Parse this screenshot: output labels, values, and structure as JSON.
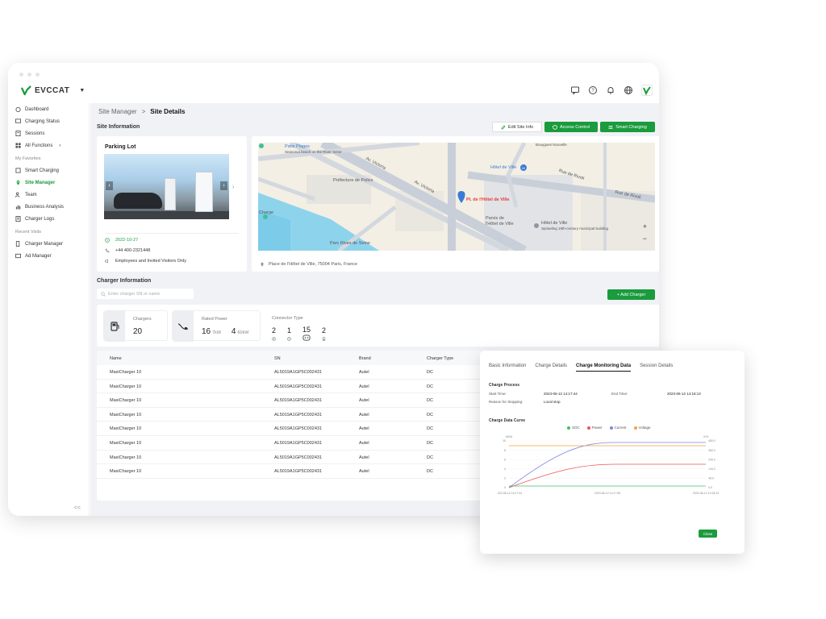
{
  "app": {
    "name": "EVCCAT"
  },
  "colors": {
    "accent": "#1a9b3d",
    "soc": "#3fbf6b",
    "power": "#ef5350",
    "current": "#7e87e0",
    "voltage": "#f2a23c"
  },
  "topbar": {
    "icons": [
      "message-icon",
      "help-icon",
      "bell-icon",
      "globe-icon",
      "brand-icon"
    ]
  },
  "sidebar": {
    "items": [
      {
        "label": "Dashboard",
        "icon": "dashboard-icon"
      },
      {
        "label": "Charging Status",
        "icon": "monitor-icon"
      },
      {
        "label": "Sessions",
        "icon": "list-icon"
      },
      {
        "label": "All Functions",
        "icon": "grid-icon"
      }
    ],
    "favorites_label": "My Favorites",
    "favorites": [
      {
        "label": "Smart Charging",
        "icon": "smart-icon"
      },
      {
        "label": "Site Manager",
        "icon": "location-icon"
      },
      {
        "label": "Team",
        "icon": "team-icon"
      },
      {
        "label": "Business Analysis",
        "icon": "analysis-icon"
      },
      {
        "label": "Charger Logs",
        "icon": "logs-icon"
      }
    ],
    "recent_label": "Recent Visits",
    "recent": [
      {
        "label": "Charger Manager",
        "icon": "charger-icon"
      },
      {
        "label": "Ad Manager",
        "icon": "ad-icon"
      }
    ],
    "collapse": "<<"
  },
  "breadcrumb": {
    "parent": "Site Manager",
    "sep": ">",
    "current": "Site Details"
  },
  "site_info": {
    "title": "Site Information",
    "edit_btn": "Edit Site Info",
    "access_btn": "Access Control",
    "smart_btn": "Smart Charging",
    "parking_title": "Parking Lot",
    "date": "2022-10-27",
    "phone": "+44 400-2321448",
    "access": "Employees and Invited Visitors Only"
  },
  "map": {
    "labels": {
      "paris_plages": "Paris Plages",
      "paris_plages_sub": "Seasonal beach on the River Seine",
      "prefecture": "Préfecture de Police",
      "av_victoria1": "Av. Victoria",
      "av_victoria2": "Av. Victoria",
      "hotel_ville_metro": "Hôtel de Ville",
      "rue_rivoli1": "Rue de Rivoli",
      "rue_rivoli2": "Rue de Rivoli",
      "pl_hotel": "Pl. de l'Hôtel de Ville",
      "parvis": "Parvis de",
      "parvis2": "l'Hôtel de Ville",
      "hotel_ville": "Hôtel de Ville",
      "hotel_sub": "Sprawling 19th-century municipal building",
      "charge": "Charge",
      "parc_rives": "Parc Rives de Seine",
      "top_label": "Bouygues Nouvelle"
    },
    "zoom_in": "+",
    "zoom_out": "−",
    "address": "Place de l'Hôtel de Ville, 75004 Paris, France"
  },
  "charger_info": {
    "title": "Charger Information",
    "search_placeholder": "Enter charger SN or name",
    "add_btn": "+ Add Charger",
    "chargers_label": "Chargers",
    "chargers_value": "20",
    "rated_label": "Rated Power",
    "rated_1_count": "16",
    "rated_1_unit": "7kW",
    "rated_2_count": "4",
    "rated_2_unit": "60kW",
    "connector_label": "Connector Type",
    "connectors": [
      "2",
      "1",
      "15",
      "2"
    ]
  },
  "table": {
    "headers": {
      "name": "Name",
      "sn": "SN",
      "brand": "Brand",
      "type": "Charger Type"
    },
    "rows": [
      {
        "name": "MaxiCharger 10",
        "sn": "AL5019A1GP5C002431",
        "brand": "Autel",
        "type": "DC"
      },
      {
        "name": "MaxiCharger 10",
        "sn": "AL5019A1GP5C002431",
        "brand": "Autel",
        "type": "DC"
      },
      {
        "name": "MaxiCharger 10",
        "sn": "AL5019A1GP5C002431",
        "brand": "Autel",
        "type": "DC"
      },
      {
        "name": "MaxiCharger 10",
        "sn": "AL5019A1GP5C002431",
        "brand": "Autel",
        "type": "DC"
      },
      {
        "name": "MaxiCharger 10",
        "sn": "AL5019A1GP5C002431",
        "brand": "Autel",
        "type": "DC"
      },
      {
        "name": "MaxiCharger 10",
        "sn": "AL5019A1GP5C002431",
        "brand": "Autel",
        "type": "DC"
      },
      {
        "name": "MaxiCharger 10",
        "sn": "AL5019A1GP5C002431",
        "brand": "Autel",
        "type": "DC"
      },
      {
        "name": "MaxiCharger 10",
        "sn": "AL5019A1GP5C002431",
        "brand": "Autel",
        "type": "DC"
      }
    ]
  },
  "modal": {
    "tabs": [
      "Basic Information",
      "Charge Details",
      "Charge Monitoring Data",
      "Session Details"
    ],
    "active_tab": 2,
    "process_title": "Charge Process",
    "start_label": "Start Time:",
    "start_value": "2023-06-12 14:17:44",
    "end_label": "End Time:",
    "end_value": "2023-06-12 14:18:13",
    "reason_label": "Reason for Stopping:",
    "reason_value": "Local stop",
    "curve_title": "Charge Data Curve",
    "close_btn": "Close"
  },
  "chart_data": {
    "type": "line",
    "title": "Charge Data Curve",
    "series": [
      {
        "name": "SOC",
        "color": "#3fbf6b"
      },
      {
        "name": "Power",
        "color": "#ef5350"
      },
      {
        "name": "Current",
        "color": "#7e87e0"
      },
      {
        "name": "Voltage",
        "color": "#f2a23c"
      }
    ],
    "y_left_label": "kW/A",
    "y_left_ticks": [
      "10",
      "8",
      "6",
      "4",
      "2",
      "0"
    ],
    "y_right_label": "V/%",
    "y_right_ticks": [
      "480.0",
      "360.0",
      "240.0",
      "144.0",
      "48.0",
      "0.0"
    ],
    "x_ticks": [
      "2023-06-12 14:17:44",
      "2023-06-12 14:17:59",
      "2023-06-12 14:18:13"
    ]
  }
}
